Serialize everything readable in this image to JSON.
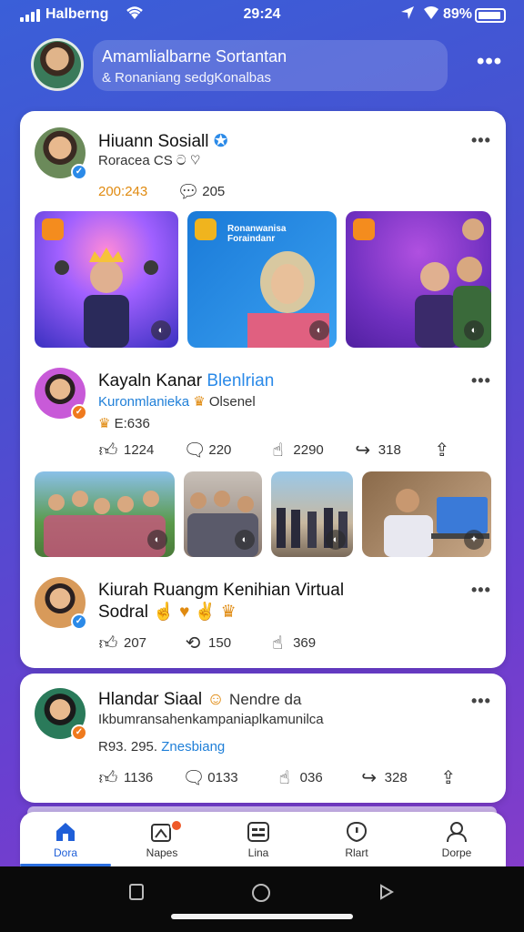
{
  "status": {
    "carrier": "Halberng",
    "time": "29:24",
    "battery": "89%"
  },
  "profile": {
    "name": "Amamlialbarne Sortantan",
    "subtitle": "& Ronaniang sedgKonalbas"
  },
  "posts": [
    {
      "title": "Hiuann Sosiall",
      "subtitle": "Roracea",
      "subtitle_extra": "CS ට ♡",
      "stat_time": "200:243",
      "stat_comments": "205",
      "images": [
        {
          "tag_color": "#f48c1e"
        },
        {
          "tag_color": "#f0b41e",
          "caption": "Ronanwanisa Foraindanr"
        },
        {
          "tag_color": "#f48c1e"
        }
      ]
    },
    {
      "title": "Kayaln Kanar",
      "title_tail": "Blenlrian",
      "subtitle": "Kuronmlanieka",
      "subtitle_tail": "Olsenel",
      "meta": "E:636",
      "actions": {
        "like": "1224",
        "comment": "220",
        "react": "2290",
        "share": "318"
      }
    },
    {
      "title": "Kiurah Ruangm Kenihian Virtual",
      "title_line2": "Sodral",
      "actions": {
        "like": "207",
        "comment": "150",
        "react": "369"
      }
    },
    {
      "title": "Hlandar Siaal",
      "title_tail": "Nendre da",
      "subtitle": "Ikbumransahenkampaniaplkamunilca",
      "meta_prefix": "R93. 295.",
      "meta_link": "Znesbiang",
      "actions": {
        "like": "1136",
        "comment": "0133",
        "react": "036",
        "share": "328"
      }
    }
  ],
  "tabs": [
    {
      "label": "Dora",
      "icon": "home-icon",
      "active": true
    },
    {
      "label": "Napes",
      "icon": "image-notification-icon",
      "active": false
    },
    {
      "label": "Lina",
      "icon": "message-board-icon",
      "active": false
    },
    {
      "label": "Rlart",
      "icon": "alert-shield-icon",
      "active": false
    },
    {
      "label": "Dorpe",
      "icon": "profile-icon",
      "active": false
    }
  ],
  "colors": {
    "accent": "#2b6fe0",
    "verified": "#2b8ae8",
    "badge_orange": "#ef7a1e",
    "background_top": "#3a5fd8",
    "background_bottom": "#8a3cc8"
  }
}
